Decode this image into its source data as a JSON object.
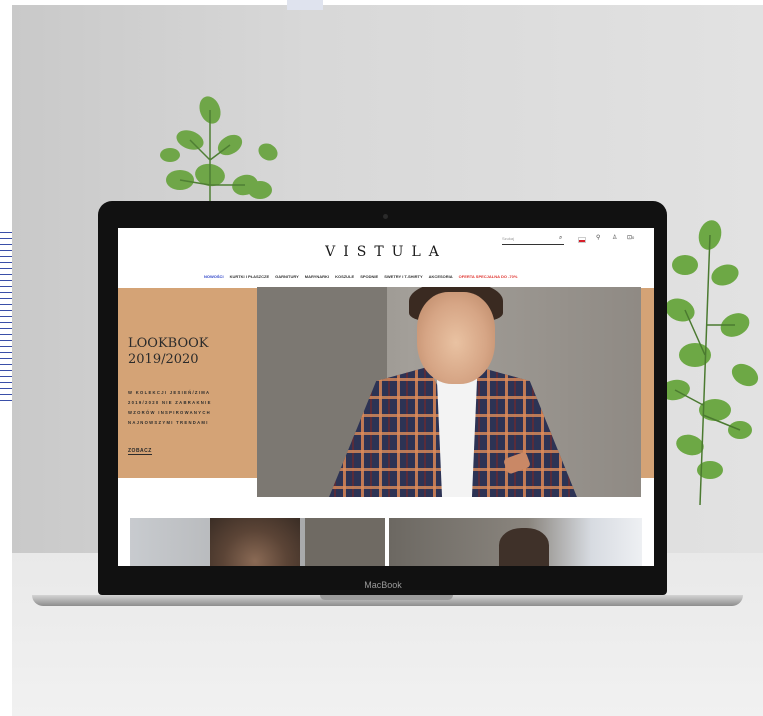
{
  "device": {
    "label": "MacBook"
  },
  "site": {
    "logo": "VISTULA",
    "header": {
      "search_placeholder": "Szukaj",
      "icons": [
        "search-icon",
        "flag-pl-icon",
        "location-pin-icon",
        "user-icon",
        "cart-icon"
      ],
      "cart_count": "0"
    },
    "nav": [
      {
        "label": "NOWOŚCI",
        "type": "new"
      },
      {
        "label": "KURTKI I PŁASZCZE"
      },
      {
        "label": "GARNITURY"
      },
      {
        "label": "MARYNARKI"
      },
      {
        "label": "KOSZULE"
      },
      {
        "label": "SPODNIE"
      },
      {
        "label": "SWETRY I T-SHIRTY"
      },
      {
        "label": "AKCESORIA"
      },
      {
        "label": "OFERTA SPECJALNA DO -70%",
        "type": "sale"
      }
    ],
    "hero": {
      "title": "LOOKBOOK 2019/2020",
      "description": "W KOLEKCJI JESIEŃ/ZIMA 2019/2020 NIE ZABRAKNIE WZORÓW INSPIROWANYCH NAJNOWSZYMI TRENDAMI",
      "cta": "ZOBACZ"
    },
    "colors": {
      "hero_band": "#d4a376",
      "nav_new": "#2e44c8",
      "nav_sale": "#e03530"
    }
  }
}
